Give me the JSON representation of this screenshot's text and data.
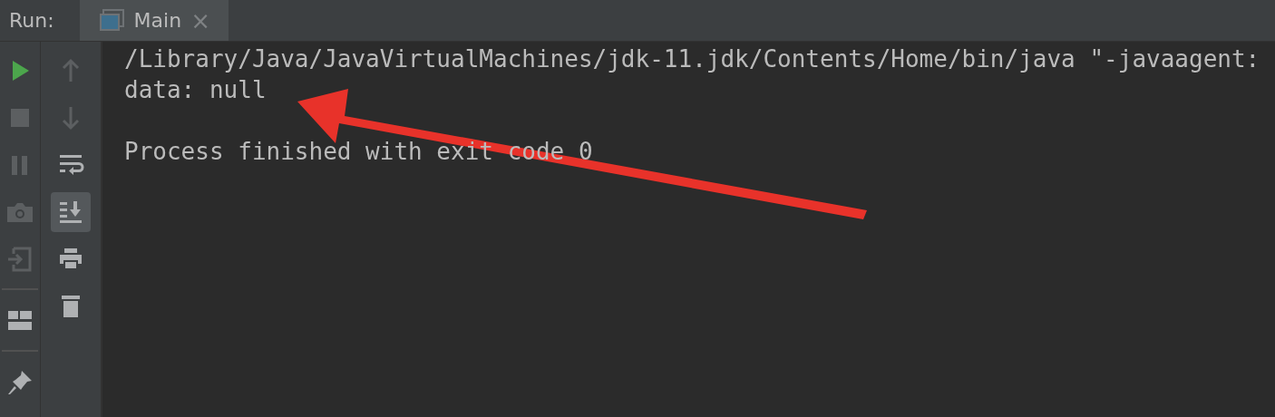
{
  "header": {
    "label": "Run:",
    "tabs": [
      {
        "label": "Main",
        "selected": true,
        "close": "×"
      }
    ]
  },
  "left_toolbar": [
    {
      "kind": "run",
      "disabled": false
    },
    {
      "kind": "stop",
      "disabled": true
    },
    {
      "kind": "pause",
      "disabled": true
    },
    {
      "kind": "camera",
      "disabled": true
    },
    {
      "kind": "exit",
      "disabled": true
    },
    {
      "kind": "separator"
    },
    {
      "kind": "layout",
      "disabled": false
    },
    {
      "kind": "separator"
    },
    {
      "kind": "pin",
      "disabled": false
    }
  ],
  "console_toolbar": [
    {
      "kind": "up",
      "disabled": true,
      "selected": false
    },
    {
      "kind": "down",
      "disabled": true,
      "selected": false
    },
    {
      "kind": "wrap",
      "disabled": false,
      "selected": false
    },
    {
      "kind": "scroll-end",
      "disabled": false,
      "selected": true
    },
    {
      "kind": "print",
      "disabled": false,
      "selected": false
    },
    {
      "kind": "trash",
      "disabled": false,
      "selected": false
    }
  ],
  "console": {
    "lines": [
      {
        "kind": "output",
        "text": "/Library/Java/JavaVirtualMachines/jdk-11.jdk/Contents/Home/bin/java \"-javaagent:"
      },
      {
        "kind": "output",
        "text": "data: null"
      },
      {
        "kind": "status",
        "text": "Process finished with exit code 0"
      }
    ]
  },
  "annotation": {
    "kind": "arrow",
    "color": "#e8322a"
  }
}
